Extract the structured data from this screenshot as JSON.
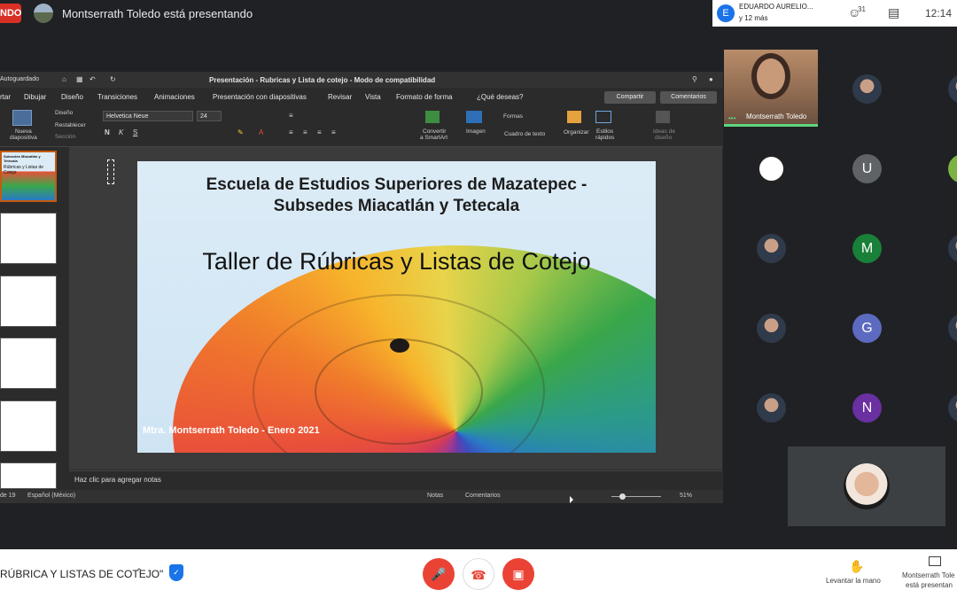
{
  "meet": {
    "live_badge": "NDO",
    "presenter_banner": "Montserrath Toledo está presentando",
    "viewer_initial": "E",
    "viewer_name": "EDUARDO AURELIO...",
    "viewer_more": "y 12 más",
    "people_count": "31",
    "clock": "12:14",
    "meeting_title": "RÚBRICA Y LISTAS DE COTEJO\"",
    "raise_hand_label": "Levantar la mano",
    "presenting_label_1": "Montserrath Tole",
    "presenting_label_2": "está presentan",
    "self_name": "Montserrath Toledo",
    "accent_red": "#ea4335",
    "accent_green": "#5fd67e"
  },
  "participants": [
    {
      "initial": "U",
      "color": "#5f6368"
    },
    {
      "initial": "M",
      "color": "#188038"
    },
    {
      "initial": "G",
      "color": "#5c6bc0"
    },
    {
      "initial": "N",
      "color": "#6a2fa0"
    }
  ],
  "ppt": {
    "autosave": "Autoguardado",
    "window_title": "Presentación - Rubricas y Lista de cotejo  -  Modo de compatibilidad",
    "tabs": [
      "rtar",
      "Dibujar",
      "Diseño",
      "Transiciones",
      "Animaciones",
      "Presentación con diapositivas",
      "Revisar",
      "Vista",
      "Formato de forma",
      "¿Qué deseas?"
    ],
    "share": "Compartir",
    "comments": "Comentarios",
    "ribbon": {
      "new_slide": "Nueva",
      "new_slide_2": "diapositiva",
      "design": "Diseño",
      "reset": "Restablecer",
      "section": "Sección",
      "font": "Helvetica Neue",
      "font_size": "24",
      "convert_1": "Convertir",
      "convert_2": "a SmartArt",
      "image": "Imagen",
      "shapes": "Formas",
      "textbox": "Cuadro de texto",
      "arrange": "Organizar",
      "quick_styles_1": "Estilos",
      "quick_styles_2": "rápidos",
      "ideas_1": "Ideas de",
      "ideas_2": "diseño"
    },
    "notes_placeholder": "Haz clic para agregar notas",
    "status_slide": "de 19",
    "status_lang": "Español (México)",
    "status_notes": "Notas",
    "status_comments": "Comentarios",
    "zoom": "51%",
    "thumb_title": "Subsedes Miacatlán y Tetecala",
    "thumb_main": "Rúbricas y Listas de Cotejo"
  },
  "slide": {
    "line1": "Escuela de Estudios Superiores de Mazatepec -",
    "line2": "Subsedes Miacatlán y Tetecala",
    "title": "Taller de Rúbricas y Listas de Cotejo",
    "author": "Mtra. Montserrath Toledo - Enero 2021"
  }
}
